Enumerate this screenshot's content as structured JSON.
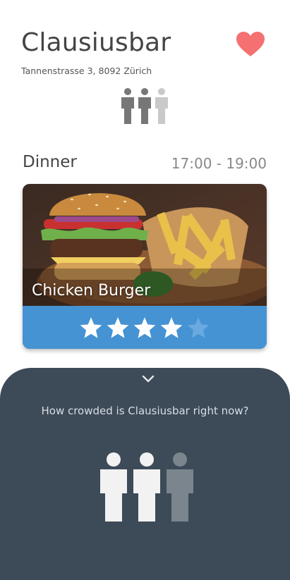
{
  "restaurant": {
    "name": "Clausiusbar",
    "address": "Tannenstrasse 3, 8092 Zürich",
    "favorite": true,
    "crowd_level": 2,
    "crowd_max": 3
  },
  "meal": {
    "label": "Dinner",
    "time": "17:00 - 19:00"
  },
  "dish": {
    "name": "Chicken Burger",
    "rating": 4,
    "rating_max": 5
  },
  "crowd_sheet": {
    "question": "How crowded is Clausiusbar right now?",
    "icon": "chevron-down-icon"
  },
  "colors": {
    "heart": "#f57070",
    "rating_bar": "#4593d3",
    "sheet": "#3d4a58",
    "person_filled": "#f2f2f2",
    "person_dim": "#7b858d"
  }
}
